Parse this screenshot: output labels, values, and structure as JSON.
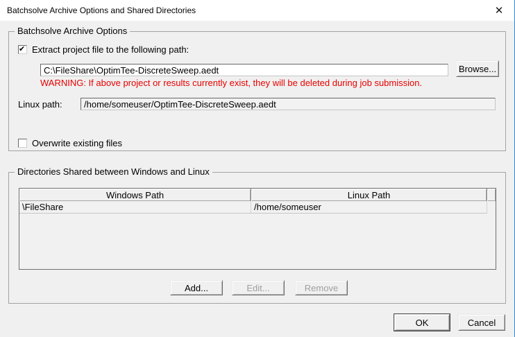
{
  "window": {
    "title": "Batchsolve Archive Options and Shared Directories",
    "close_glyph": "✕"
  },
  "archive_options": {
    "title": "Batchsolve Archive Options",
    "extract_checkbox": {
      "label": "Extract project file to the following path:",
      "checked": true
    },
    "windows_path_value": "C:\\FileShare\\OptimTee-DiscreteSweep.aedt",
    "browse_label": "Browse...",
    "warning": "WARNING: If above project or results currently exist, they will be deleted during job submission.",
    "linux_path_label": "Linux path:",
    "linux_path_value": "/home/someuser/OptimTee-DiscreteSweep.aedt",
    "overwrite_checkbox": {
      "label": "Overwrite existing files",
      "checked": false
    }
  },
  "shared_directories": {
    "title": "Directories Shared between Windows and Linux",
    "table": {
      "columns": [
        "Windows Path",
        "Linux Path"
      ],
      "rows": [
        [
          "\\FileShare",
          "/home/someuser"
        ]
      ]
    },
    "add_label": "Add...",
    "edit_label": "Edit...",
    "remove_label": "Remove"
  },
  "footer": {
    "ok_label": "OK",
    "cancel_label": "Cancel"
  },
  "colors": {
    "warning_red": "#e80000",
    "window_border_blue": "#2988d8",
    "dialog_bg": "#f0f0f0"
  }
}
